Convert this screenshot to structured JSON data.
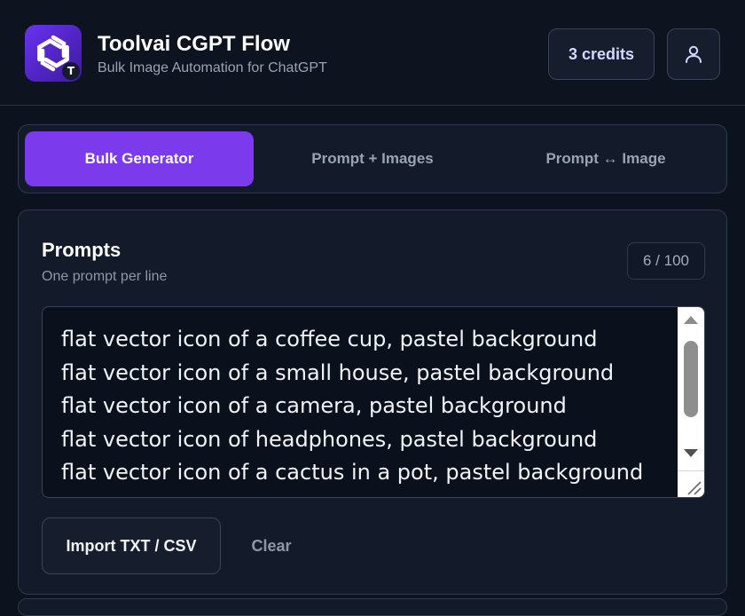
{
  "app": {
    "title": "Toolvai CGPT Flow",
    "subtitle": "Bulk Image Automation for ChatGPT",
    "logo_icon": "openai-knot-icon",
    "logo_badge": "T"
  },
  "header": {
    "credits_label": "3 credits",
    "profile_icon": "user-icon"
  },
  "tabs": [
    {
      "label": "Bulk Generator",
      "active": true
    },
    {
      "label": "Prompt + Images",
      "active": false
    },
    {
      "label": "Prompt ↔ Image",
      "active": false
    }
  ],
  "prompts": {
    "title": "Prompts",
    "subtitle": "One prompt per line",
    "counter": "6 / 100",
    "lines": [
      "flat vector icon of a coffee cup, pastel background",
      "flat vector icon of a small house, pastel background",
      "flat vector icon of a camera, pastel background",
      "flat vector icon of headphones, pastel background",
      "flat vector icon of a cactus in a pot, pastel background"
    ],
    "import_label": "Import TXT / CSV",
    "clear_label": "Clear"
  },
  "colors": {
    "accent": "#7c3aed",
    "background": "#0c121e",
    "panel": "#131b2a",
    "border": "#2f3a4f"
  }
}
